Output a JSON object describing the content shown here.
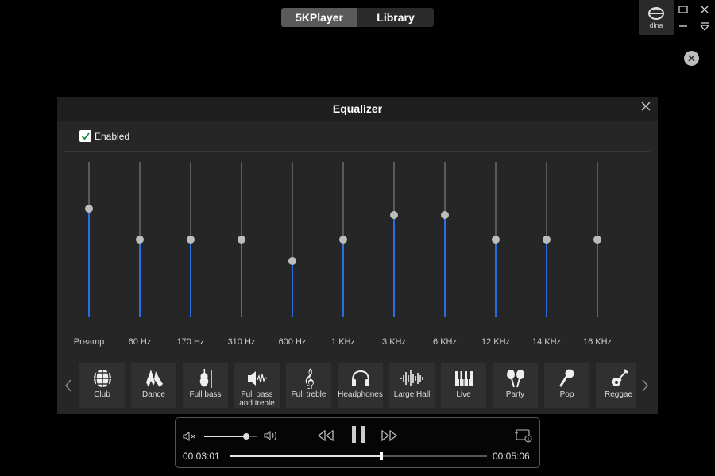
{
  "top_tabs": [
    {
      "label": "5KPlayer",
      "active": true
    },
    {
      "label": "Library",
      "active": false
    }
  ],
  "dlna": {
    "label": "dlna"
  },
  "equalizer": {
    "title": "Equalizer",
    "enabled_label": "Enabled",
    "enabled": true,
    "bands": [
      {
        "label": "Preamp",
        "level": 0.7
      },
      {
        "label": "60 Hz",
        "level": 0.5
      },
      {
        "label": "170 Hz",
        "level": 0.5
      },
      {
        "label": "310 Hz",
        "level": 0.5
      },
      {
        "label": "600 Hz",
        "level": 0.36
      },
      {
        "label": "1 KHz",
        "level": 0.5
      },
      {
        "label": "3 KHz",
        "level": 0.66
      },
      {
        "label": "6 KHz",
        "level": 0.66
      },
      {
        "label": "12 KHz",
        "level": 0.5
      },
      {
        "label": "14 KHz",
        "level": 0.5
      },
      {
        "label": "16 KHz",
        "level": 0.5
      }
    ],
    "presets": [
      {
        "label": "Club",
        "icon": "disco-ball-icon"
      },
      {
        "label": "Dance",
        "icon": "dance-shoes-icon"
      },
      {
        "label": "Full bass",
        "icon": "violin-icon"
      },
      {
        "label": "Full bass and treble",
        "icon": "speaker-wave-icon"
      },
      {
        "label": "Full treble",
        "icon": "treble-clef-icon"
      },
      {
        "label": "Headphones",
        "icon": "headphones-icon"
      },
      {
        "label": "Large Hall",
        "icon": "soundwave-icon"
      },
      {
        "label": "Live",
        "icon": "piano-keys-icon"
      },
      {
        "label": "Party",
        "icon": "maracas-icon"
      },
      {
        "label": "Pop",
        "icon": "microphone-icon"
      },
      {
        "label": "Reggae",
        "icon": "guitar-icon"
      }
    ]
  },
  "player": {
    "current_time": "00:03:01",
    "total_time": "00:05:06",
    "progress": 0.59,
    "volume": 0.8,
    "repeat_badge": "1"
  },
  "colors": {
    "accent": "#2a6fe0",
    "panel": "#262626",
    "background": "#000000"
  }
}
